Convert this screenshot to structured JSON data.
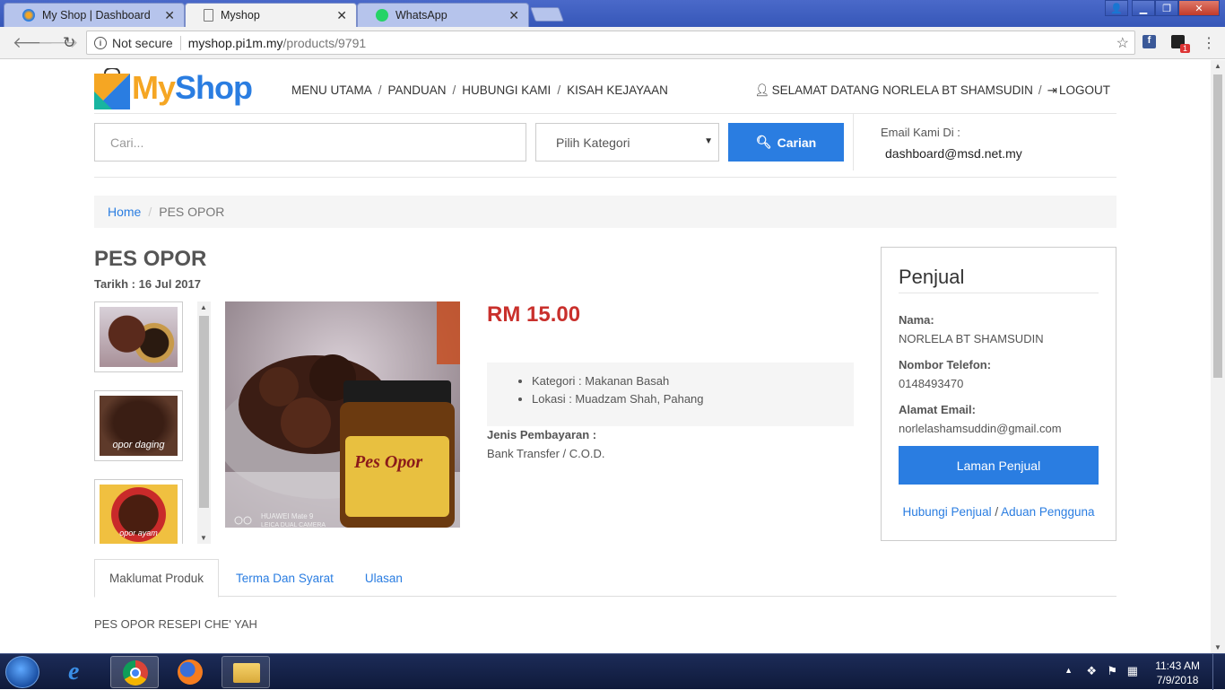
{
  "browser": {
    "tabs": [
      {
        "title": "My Shop | Dashboard",
        "active": false
      },
      {
        "title": "Myshop",
        "active": true
      },
      {
        "title": "WhatsApp",
        "active": false
      }
    ],
    "security_label": "Not secure",
    "url_domain": "myshop.pi1m.my",
    "url_path": "/products/9791",
    "extension_badge": "1"
  },
  "header": {
    "logo_my": "My",
    "logo_shop": "Shop",
    "nav": [
      "MENU UTAMA",
      "PANDUAN",
      "HUBUNGI KAMI",
      "KISAH KEJAYAAN"
    ],
    "welcome": "SELAMAT DATANG NORLELA BT SHAMSUDIN",
    "logout": "LOGOUT",
    "search_placeholder": "Cari...",
    "category_select": "Pilih Kategori",
    "search_button": "Carian",
    "email_label": "Email Kami Di :",
    "email_address": "dashboard@msd.net.my"
  },
  "breadcrumb": {
    "home": "Home",
    "current": "PES OPOR"
  },
  "product": {
    "title": "PES OPOR",
    "date": "Tarikh : 16 Jul 2017",
    "price": "RM 15.00",
    "details": [
      "Kategori : Makanan Basah",
      "Lokasi : Muadzam Shah, Pahang"
    ],
    "payment_label": "Jenis Pembayaran :",
    "payment_value": "Bank Transfer / C.O.D.",
    "image_watermark": "HUAWEI Mate 9\nLEICA DUAL CAMERA",
    "jar_label": "Pes Opor",
    "thumb_captions": [
      "",
      "opor daging",
      "opor ayam"
    ]
  },
  "seller": {
    "heading": "Penjual",
    "name_label": "Nama:",
    "name": "NORLELA BT SHAMSUDIN",
    "phone_label": "Nombor Telefon:",
    "phone": "0148493470",
    "email_label": "Alamat Email:",
    "email": "norlelashamsuddin@gmail.com",
    "button": "Laman Penjual",
    "link_contact": "Hubungi Penjual",
    "link_sep": "/",
    "link_report": "Aduan Pengguna"
  },
  "tabs": [
    "Maklumat Produk",
    "Terma Dan Syarat",
    "Ulasan"
  ],
  "description": "PES OPOR RESEPI CHE' YAH",
  "taskbar": {
    "time": "11:43 AM",
    "date": "7/9/2018"
  },
  "colors": {
    "accent": "#2a7de1",
    "price": "#c9302c",
    "logo_orange": "#f5a623",
    "logo_blue": "#2a7de1"
  }
}
